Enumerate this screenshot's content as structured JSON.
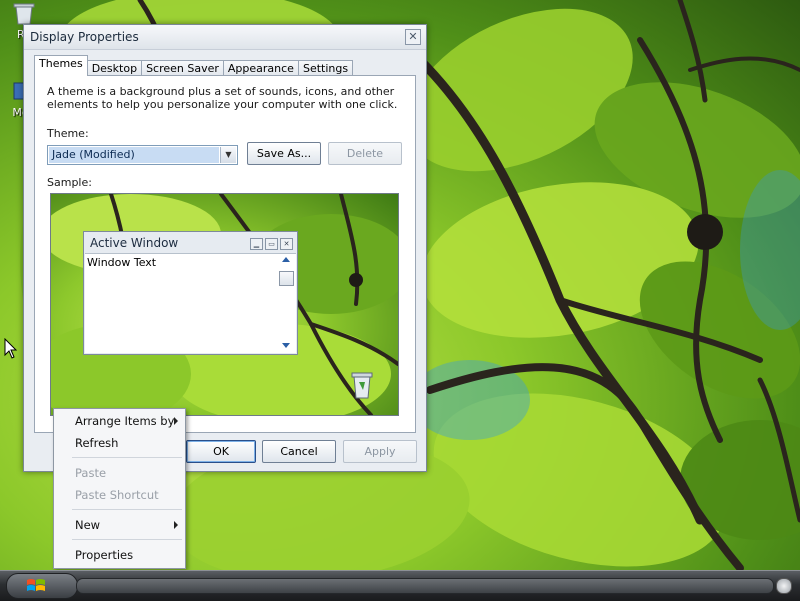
{
  "desktop": {
    "icons": [
      {
        "label": "Re",
        "icon": "recycle-bin-icon"
      },
      {
        "label": "Med",
        "icon": "media-icon"
      }
    ]
  },
  "dialog": {
    "title": "Display Properties",
    "close_glyph": "✕",
    "tabs": [
      {
        "label": "Themes",
        "active": true
      },
      {
        "label": "Desktop",
        "active": false
      },
      {
        "label": "Screen Saver",
        "active": false
      },
      {
        "label": "Appearance",
        "active": false
      },
      {
        "label": "Settings",
        "active": false
      }
    ],
    "description": "A theme is a background plus a set of sounds, icons, and other elements to help you personalize your computer with one click.",
    "theme_label": "Theme:",
    "theme_value": "Jade (Modified)",
    "save_as_label": "Save As...",
    "delete_label": "Delete",
    "sample_label": "Sample:",
    "sample_window": {
      "title": "Active Window",
      "text": "Window Text"
    },
    "ok_label": "OK",
    "cancel_label": "Cancel",
    "apply_label": "Apply"
  },
  "context_menu": {
    "items": [
      {
        "label": "Arrange Items by",
        "disabled": false,
        "submenu": true
      },
      {
        "label": "Refresh",
        "disabled": false,
        "submenu": false
      },
      {
        "label": "Paste",
        "disabled": true,
        "submenu": false
      },
      {
        "label": "Paste Shortcut",
        "disabled": true,
        "submenu": false
      },
      {
        "label": "New",
        "disabled": false,
        "submenu": true
      },
      {
        "label": "Properties",
        "disabled": false,
        "submenu": false
      }
    ]
  },
  "taskbar": {
    "start_icon": "windows-logo-icon"
  },
  "colors": {
    "wallpaper_leaf": "#8cc82a",
    "wallpaper_dark": "#2d5a10",
    "branch": "#2a241d",
    "taskbar": "#2b2e31"
  }
}
